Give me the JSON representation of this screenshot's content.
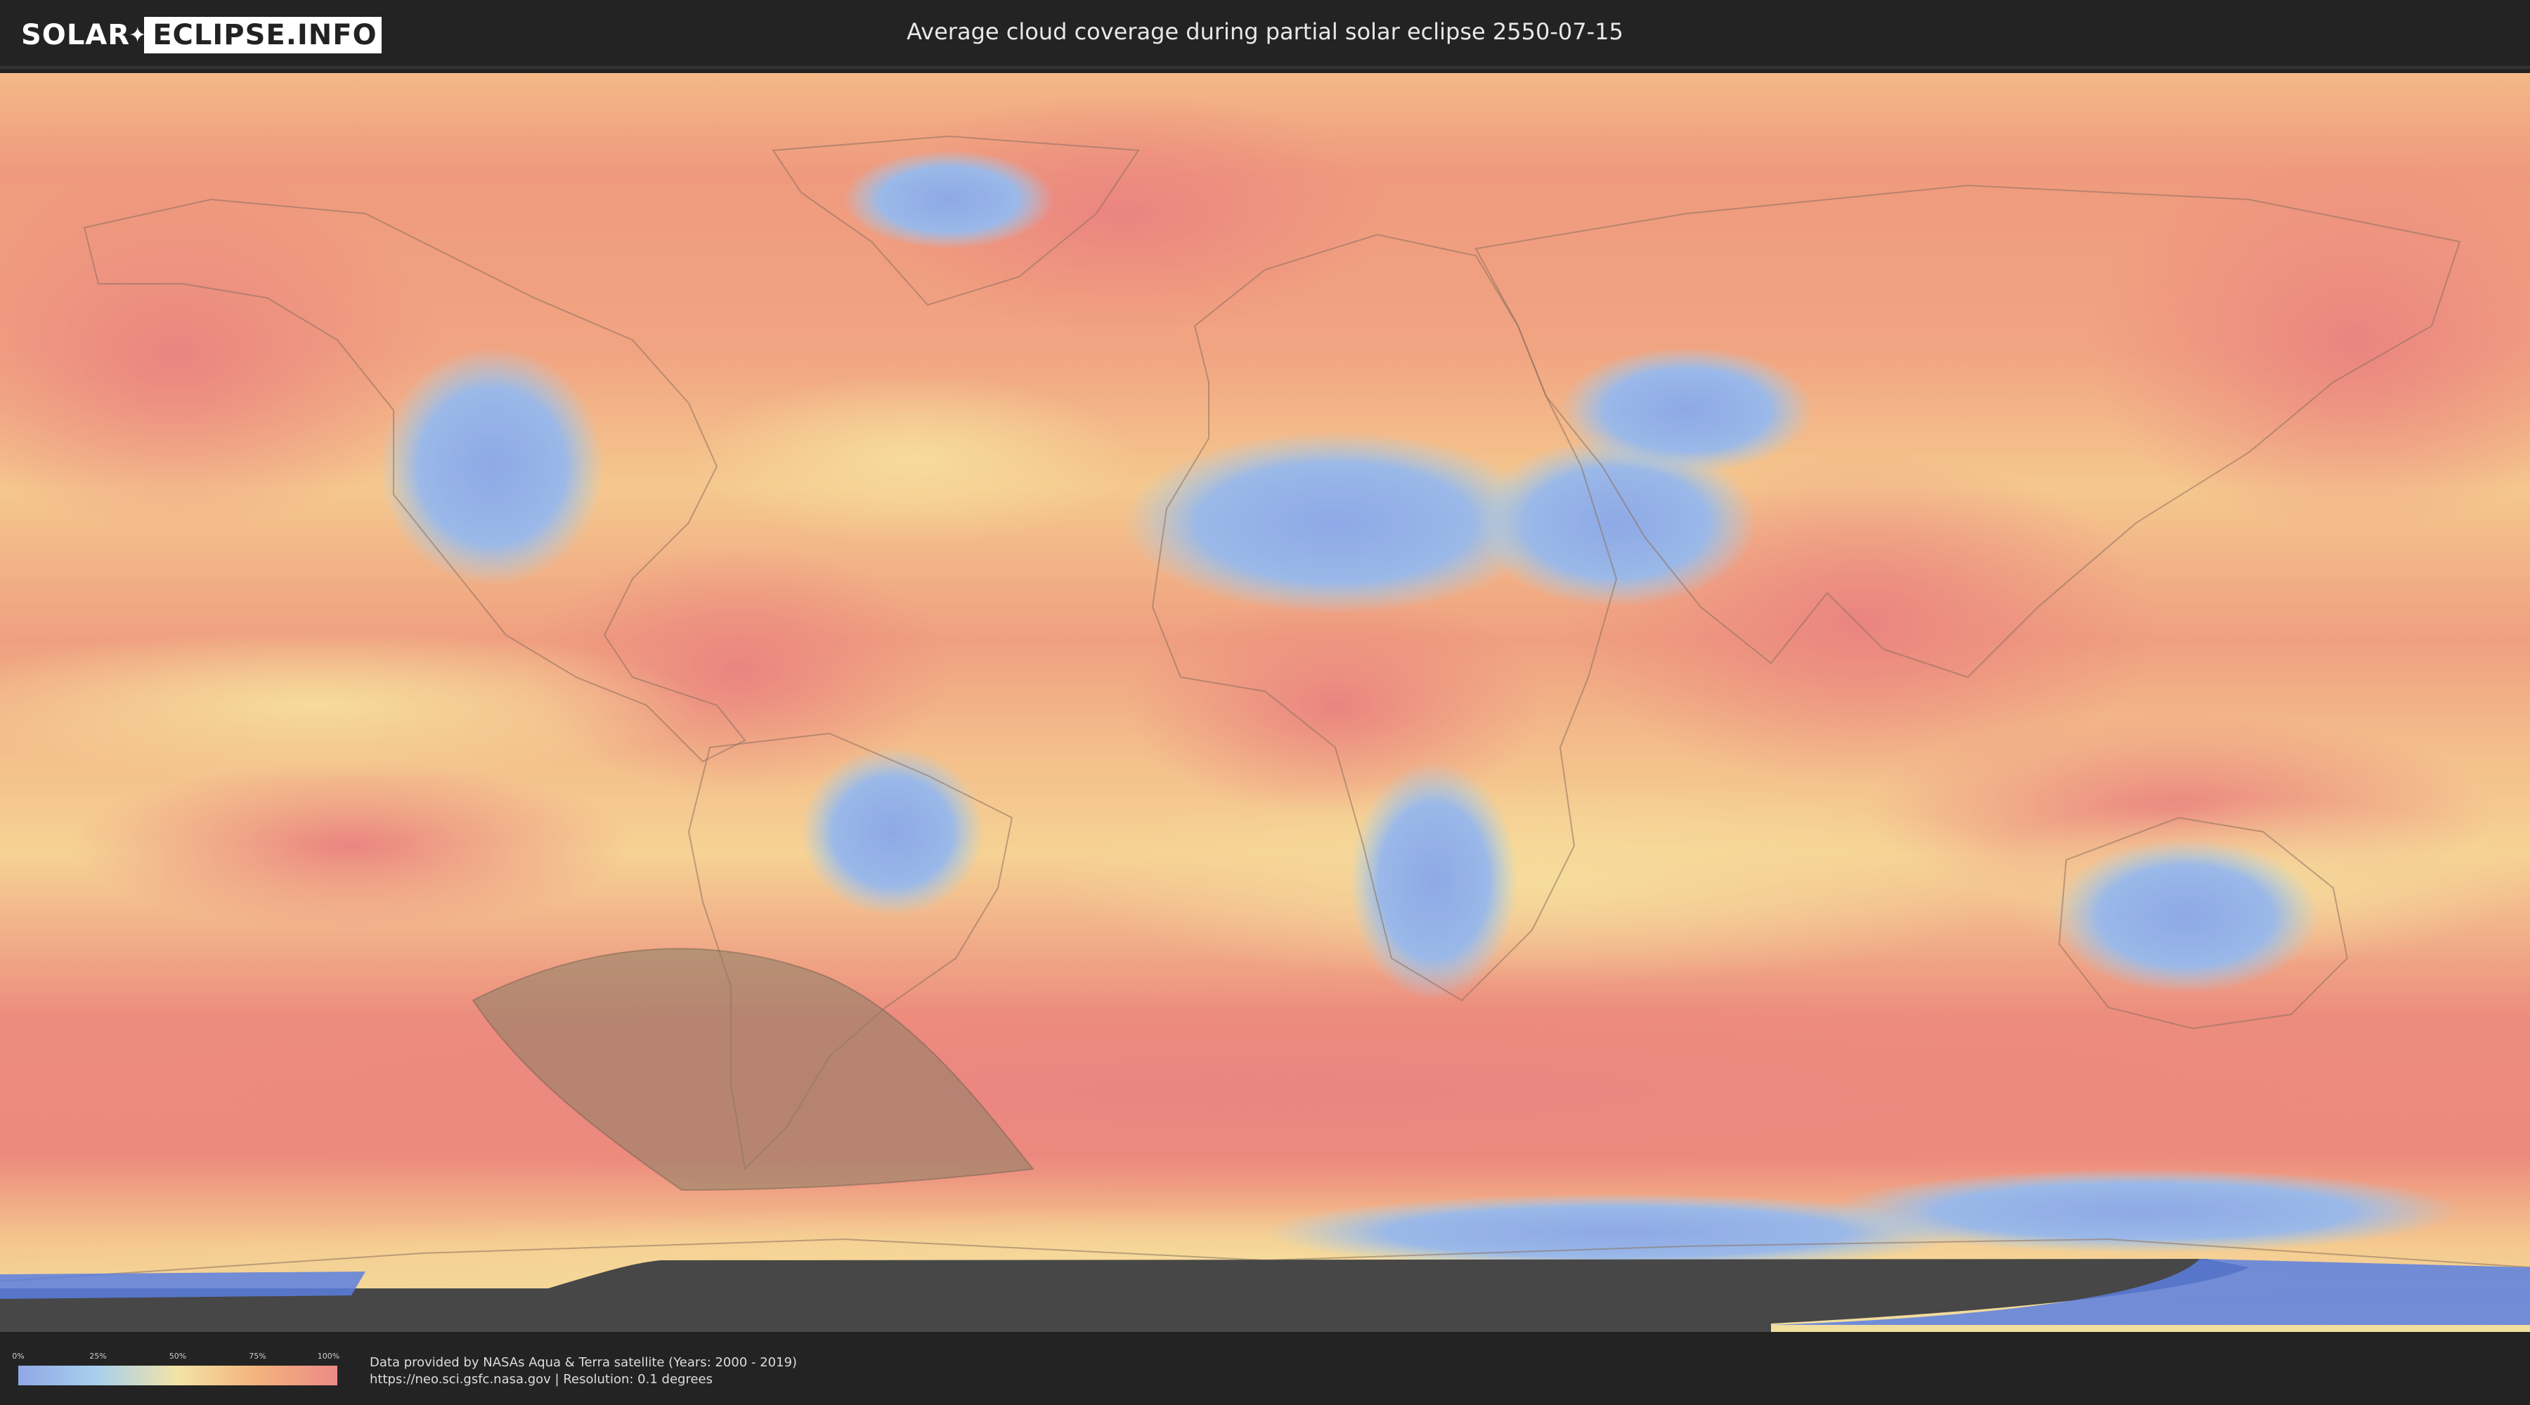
{
  "header": {
    "logo_left": "SOLAR",
    "logo_right": "ECLIPSE.INFO",
    "title": "Average cloud coverage during partial solar eclipse 2550-07-15"
  },
  "legend": {
    "ticks": [
      "0%",
      "25%",
      "50%",
      "75%",
      "100%"
    ],
    "tick_fractions": [
      0,
      0.25,
      0.5,
      0.75,
      1
    ],
    "colors": [
      "#8fa8e6",
      "#a8d0ec",
      "#f3e3a6",
      "#f3b27c",
      "#ec8a86"
    ]
  },
  "footer": {
    "credit_line1": "Data provided by NASAs Aqua & Terra satellite (Years: 2000 - 2019)",
    "credit_line2": "https://neo.sci.gsfc.nasa.gov | Resolution: 0.1 degrees"
  },
  "map": {
    "projection": "equirectangular",
    "eclipse_zone_color": "#8a8066",
    "cloud_palette": {
      "ocean_cloudy": "#ec8a80",
      "mid": "#f3c48a",
      "clear": "#8fa8e6"
    }
  }
}
